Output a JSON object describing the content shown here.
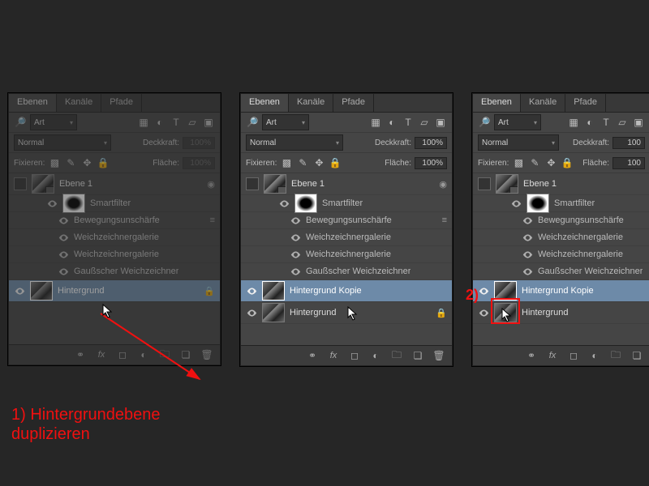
{
  "tabs": {
    "layers": "Ebenen",
    "channels": "Kanäle",
    "paths": "Pfade"
  },
  "filter": {
    "kind": "Art"
  },
  "blend": "Normal",
  "opacity_label": "Deckkraft:",
  "opacity_val": "100%",
  "lock_label": "Fixieren:",
  "fill_label": "Fläche:",
  "fill_val": "100%",
  "layer1": "Ebene 1",
  "smartfilter": "Smartfilter",
  "filters": [
    "Bewegungsunschärfe",
    "Weichzeichnergalerie",
    "Weichzeichnergalerie",
    "Gaußscher Weichzeichner"
  ],
  "bg": "Hintergrund",
  "bg_copy": "Hintergrund Kopie",
  "note1": "1) Hintergrundebene\nduplizieren",
  "note2": "2)"
}
